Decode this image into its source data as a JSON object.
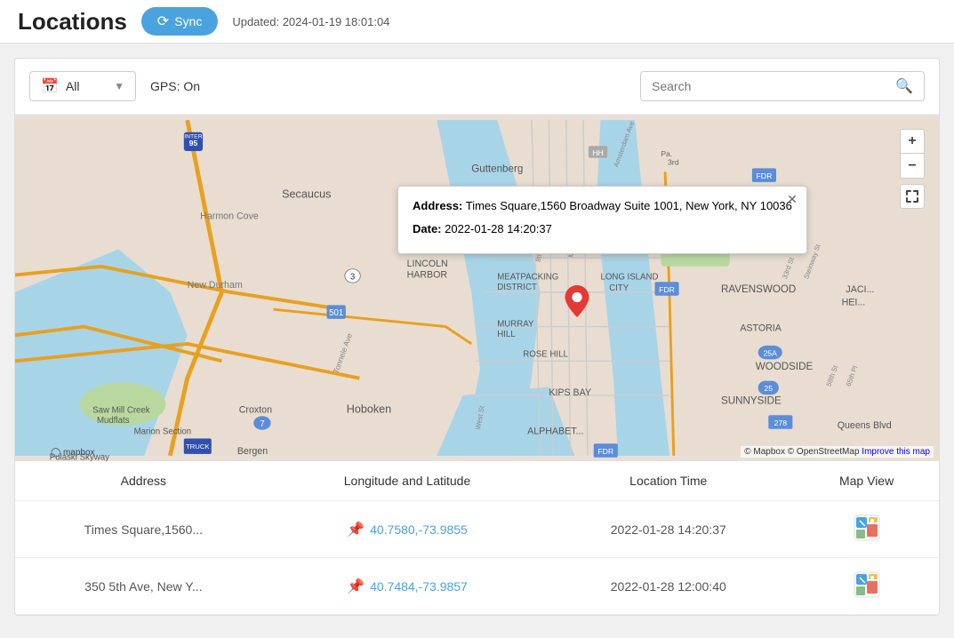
{
  "header": {
    "title": "Locations",
    "sync_label": "Sync",
    "updated_text": "Updated: 2024-01-19 18:01:04"
  },
  "toolbar": {
    "filter_label": "All",
    "gps_label": "GPS: On",
    "search_placeholder": "Search"
  },
  "map": {
    "popup": {
      "address_label": "Address:",
      "address_value": "Times Square,1560 Broadway Suite 1001, New York, NY 10036",
      "date_label": "Date:",
      "date_value": "2022-01-28 14:20:37"
    },
    "zoom_in": "+",
    "zoom_out": "−",
    "attribution": "© Mapbox © OpenStreetMap",
    "improve_link": "Improve this map"
  },
  "table": {
    "columns": [
      "Address",
      "Longitude and Latitude",
      "Location Time",
      "Map View"
    ],
    "rows": [
      {
        "address": "Times Square,1560...",
        "latlng": "40.7580,-73.9855",
        "time": "2022-01-28 14:20:37"
      },
      {
        "address": "350 5th Ave, New Y...",
        "latlng": "40.7484,-73.9857",
        "time": "2022-01-28 12:00:40"
      }
    ]
  }
}
